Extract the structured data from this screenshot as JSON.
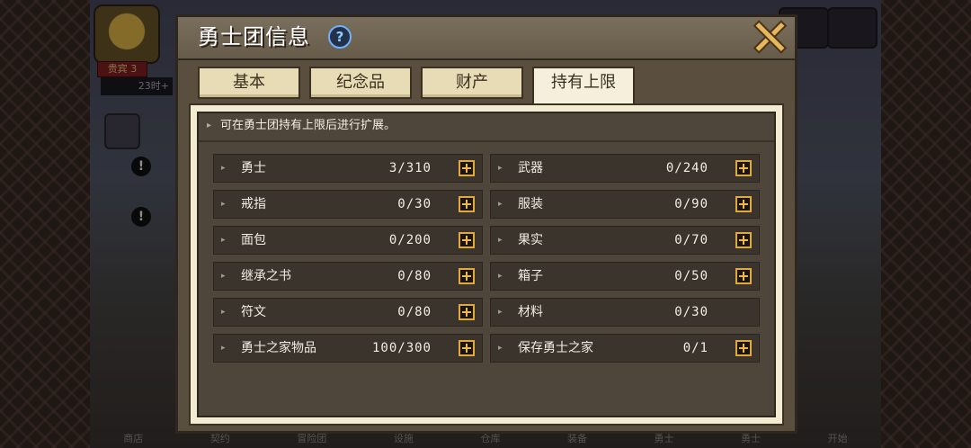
{
  "background": {
    "rank_badge": "贵宾 3",
    "timer": "23时+",
    "nav": [
      "商店",
      "契约",
      "冒险团",
      "设施",
      "仓库",
      "装备",
      "勇士",
      "勇士",
      "开始"
    ]
  },
  "dialog": {
    "title": "勇士团信息",
    "help_icon": "?",
    "tabs": [
      {
        "label": "基本",
        "active": false
      },
      {
        "label": "纪念品",
        "active": false
      },
      {
        "label": "财产",
        "active": false
      },
      {
        "label": "持有上限",
        "active": true
      }
    ],
    "notice": "可在勇士团持有上限后进行扩展。",
    "limits": [
      {
        "name": "勇士",
        "value": "3/310",
        "expandable": true
      },
      {
        "name": "武器",
        "value": "0/240",
        "expandable": true
      },
      {
        "name": "戒指",
        "value": "0/30",
        "expandable": true
      },
      {
        "name": "服装",
        "value": "0/90",
        "expandable": true
      },
      {
        "name": "面包",
        "value": "0/200",
        "expandable": true
      },
      {
        "name": "果实",
        "value": "0/70",
        "expandable": true
      },
      {
        "name": "继承之书",
        "value": "0/80",
        "expandable": true
      },
      {
        "name": "箱子",
        "value": "0/50",
        "expandable": true
      },
      {
        "name": "符文",
        "value": "0/80",
        "expandable": true
      },
      {
        "name": "材料",
        "value": "0/30",
        "expandable": false
      },
      {
        "name": "勇士之家物品",
        "value": "100/300",
        "expandable": true
      },
      {
        "name": "保存勇士之家",
        "value": "0/1",
        "expandable": true
      }
    ]
  },
  "colors": {
    "accent_gold": "#e0a93a",
    "tab_active": "#f6efdc",
    "panel_dark": "#4e463a"
  }
}
